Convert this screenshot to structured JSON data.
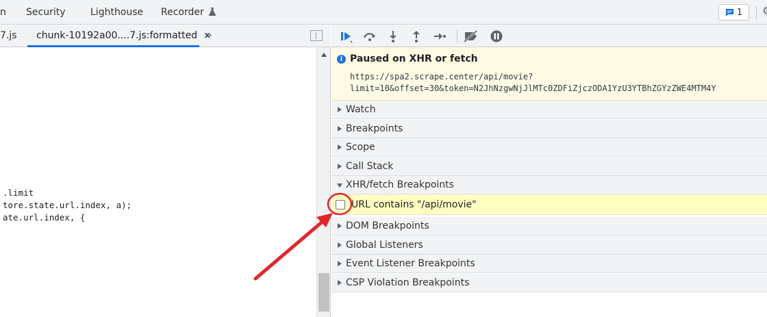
{
  "top_tabs": [
    "n",
    "Security",
    "Lighthouse",
    "Recorder"
  ],
  "issues": {
    "count": "1"
  },
  "file_tabs": {
    "partial": "7.js",
    "active": "chunk-10192a00....7.js:formatted",
    "close": "×",
    "more": "»"
  },
  "code_lines": [
    ".limit",
    "tore.state.url.index, a);",
    "ate.url.index, {"
  ],
  "debugger_toolbar": [
    "resume-icon",
    "step-over-icon",
    "step-into-icon",
    "step-out-icon",
    "step-icon",
    "deactivate-breakpoints-icon",
    "pause-on-exceptions-icon"
  ],
  "paused": {
    "title": "Paused on XHR or fetch",
    "url_line1": "https://spa2.scrape.center/api/movie?",
    "url_line2": "limit=10&offset=30&token=N2JhNzgwNjJlMTc0ZDFiZjczODA1YzU3YTBhZGYzZWE4MTM4Y"
  },
  "sections": {
    "watch": "Watch",
    "breakpoints": "Breakpoints",
    "scope": "Scope",
    "call_stack": "Call Stack",
    "xhr": "XHR/fetch Breakpoints",
    "dom": "DOM Breakpoints",
    "global": "Global Listeners",
    "event": "Event Listener Breakpoints",
    "csp": "CSP Violation Breakpoints"
  },
  "xhr_breakpoint": {
    "label": "URL contains \"/api/movie\"",
    "checked": false
  },
  "colors": {
    "accent": "#1a73e8",
    "highlight": "#ffffc2",
    "paused_bg": "#fffbe5",
    "annotation": "#e3242b"
  }
}
